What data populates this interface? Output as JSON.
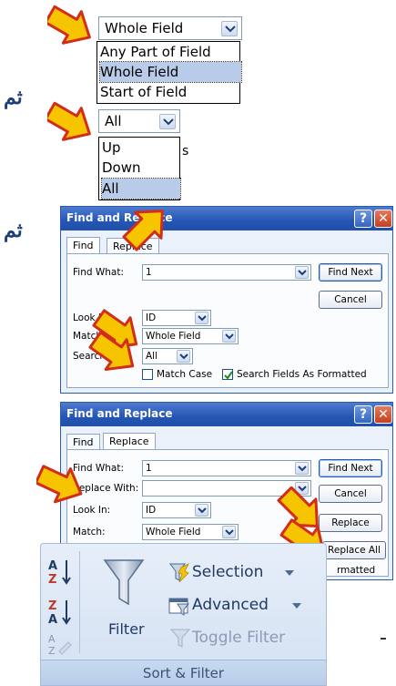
{
  "side_labels": {
    "first": "ثم",
    "second": "ثم"
  },
  "match_dropdown": {
    "value": "Whole Field",
    "options": [
      "Any Part of Field",
      "Whole Field",
      "Start of Field"
    ],
    "selected_index": 1
  },
  "search_dropdown": {
    "value": "All",
    "options": [
      "Up",
      "Down",
      "All"
    ],
    "selected_index": 2,
    "clipped_char": "s"
  },
  "find_dialog": {
    "title": "Find and Replace",
    "tabs": [
      "Find",
      "Replace"
    ],
    "active_tab": "Find",
    "find_what_label": "Find What:",
    "find_what_value": "1",
    "look_in_label": "Look In:",
    "look_in_value": "ID",
    "match_label": "Match:",
    "match_value": "Whole Field",
    "search_label": "Search:",
    "search_value": "All",
    "match_case_label": "Match Case",
    "match_case_checked": false,
    "search_formatted_label": "Search Fields As Formatted",
    "search_formatted_checked": true,
    "find_next_label": "Find Next",
    "cancel_label": "Cancel"
  },
  "replace_dialog": {
    "title": "Find and Replace",
    "tabs": [
      "Find",
      "Replace"
    ],
    "active_tab": "Replace",
    "find_what_label": "Find What:",
    "find_what_value": "1",
    "replace_with_label": "Replace With:",
    "replace_with_value": "",
    "look_in_label": "Look In:",
    "look_in_value": "ID",
    "match_label": "Match:",
    "match_value": "Whole Field",
    "find_next_label": "Find Next",
    "cancel_label": "Cancel",
    "replace_label": "Replace",
    "replace_all_label": "Replace All",
    "partial_text": "rmatted"
  },
  "ribbon": {
    "group_label": "Sort & Filter",
    "filter_label": "Filter",
    "selection_label": "Selection",
    "advanced_label": "Advanced",
    "toggle_filter_label": "Toggle Filter"
  },
  "colors": {
    "arrow_fill": "#f7c400",
    "arrow_outline": "#d22c1a",
    "title_bar": "#2556b5",
    "selected_option": "#b8cbe8"
  }
}
